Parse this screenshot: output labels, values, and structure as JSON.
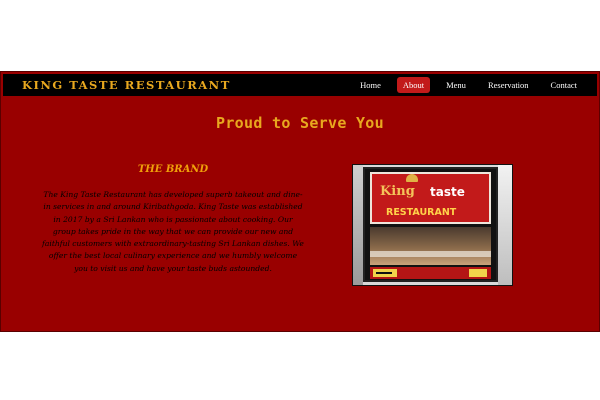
{
  "header": {
    "brand": "KING TASTE RESTAURANT",
    "nav": [
      {
        "label": "Home",
        "active": false
      },
      {
        "label": "About",
        "active": true
      },
      {
        "label": "Menu",
        "active": false
      },
      {
        "label": "Reservation",
        "active": false
      },
      {
        "label": "Contact",
        "active": false
      }
    ]
  },
  "main": {
    "title": "Proud to Serve You",
    "brand_section": {
      "heading": "THE BRAND",
      "text": "The King Taste Restaurant has developed superb takeout and dine-in services in and around Kiribathgoda. King Taste was established in 2017 by a Sri Lankan who is passionate about cooking. Our group takes pride in the way that we can provide our new and faithful customers with extraordinary-tasting Sri Lankan dishes. We offer the best local culinary experience and we humbly welcome you to visit us and have your taste buds astounded."
    },
    "photo": {
      "sign_king": "King",
      "sign_taste": "taste",
      "sign_restaurant": "RESTAURANT"
    }
  },
  "colors": {
    "background": "#990000",
    "navbar": "#000000",
    "accent": "#e8a81f",
    "active_nav": "#c21a1a"
  }
}
